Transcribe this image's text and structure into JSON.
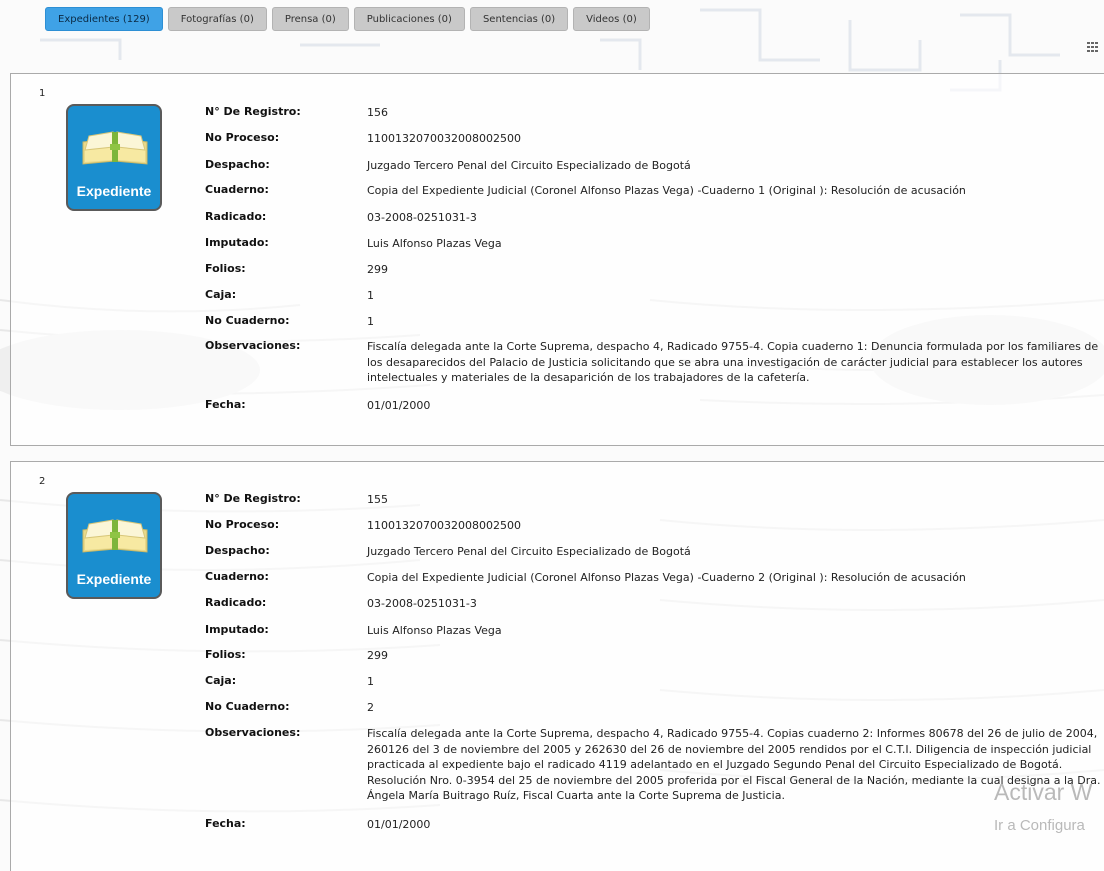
{
  "tabs": [
    {
      "label": "Expedientes (129)",
      "active": true
    },
    {
      "label": "Fotografías (0)"
    },
    {
      "label": "Prensa (0)"
    },
    {
      "label": "Publicaciones (0)"
    },
    {
      "label": "Sentencias (0)"
    },
    {
      "label": "Videos (0)"
    }
  ],
  "icons": {
    "view_toggle": "grid-icon",
    "record": "open-book-icon"
  },
  "colors": {
    "active_tab": "#3fa2e6",
    "tab": "#c9c9c9",
    "badge": "#1a8ecf",
    "book": "#f7e9a2"
  },
  "labels": {
    "registro": "N° De Registro:",
    "proceso": "No Proceso:",
    "despacho": "Despacho:",
    "cuaderno": "Cuaderno:",
    "radicado": "Radicado:",
    "imputado": "Imputado:",
    "folios": "Folios:",
    "caja": "Caja:",
    "no_cuaderno": "No Cuaderno:",
    "observaciones": "Observaciones:",
    "fecha": "Fecha:"
  },
  "badge_label": "Expediente",
  "records": [
    {
      "index": "1",
      "registro": "156",
      "proceso": "110013207003200800250​0",
      "despacho": "Juzgado Tercero Penal del Circuito Especializado de Bogotá",
      "cuaderno": "Copia del Expediente Judicial (Coronel Alfonso Plazas Vega) -Cuaderno 1 (Original ): Resolución de acusación",
      "radicado": "03-2008-0251031-3",
      "imputado": "Luis Alfonso Plazas Vega",
      "folios": "299",
      "caja": "1",
      "no_cuaderno": "1",
      "observaciones": "Fiscalía delegada ante la Corte Suprema, despacho 4, Radicado 9755-4. Copia cuaderno 1: Denuncia formulada por los familiares de los desaparecidos del Palacio de Justicia solicitando que se abra una investigación de carácter judicial para establecer los autores intelectuales y materiales de la desaparición de los trabajadores de la cafetería.",
      "fecha": "01/01/2000"
    },
    {
      "index": "2",
      "registro": "155",
      "proceso": "110013207003200800250​0",
      "despacho": "Juzgado Tercero Penal del Circuito Especializado de Bogotá",
      "cuaderno": "Copia del Expediente Judicial (Coronel Alfonso Plazas Vega) -Cuaderno 2 (Original ): Resolución de acusación",
      "radicado": "03-2008-0251031-3",
      "imputado": "Luis Alfonso Plazas Vega",
      "folios": "299",
      "caja": "1",
      "no_cuaderno": "2",
      "observaciones": "Fiscalía delegada ante la Corte Suprema, despacho 4, Radicado 9755-4. Copias cuaderno 2: Informes 80678 del 26 de julio de 2004, 260126 del 3 de noviembre del 2005 y 262630 del 26 de noviembre del 2005 rendidos por el C.T.I. Diligencia de inspección judicial practicada al expediente bajo el radicado 4119 adelantado en el Juzgado Segundo Penal del Circuito Especializado de Bogotá. Resolución Nro. 0-3954 del 25 de noviembre del 2005 proferida por el Fiscal General de la Nación, mediante la cual designa a la Dra. Ángela María Buitrago Ruíz, Fiscal Cuarta ante la Corte Suprema de Justicia.",
      "fecha": "01/01/2000"
    }
  ],
  "os_watermark": {
    "line1": "Activar W",
    "line2": "Ir a Configura"
  }
}
